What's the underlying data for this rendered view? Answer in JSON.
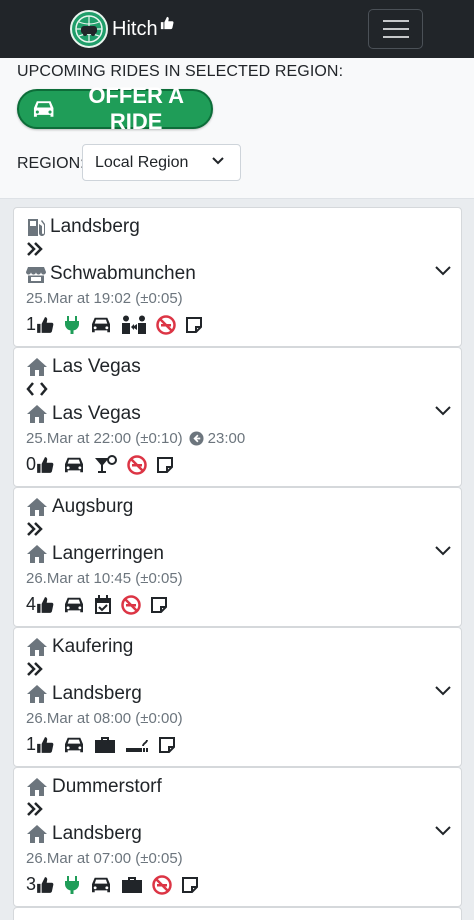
{
  "nav": {
    "brand": "Hitch"
  },
  "header": {
    "title": "UPCOMING RIDES IN SELECTED REGION:",
    "offer_button": "OFFER A RIDE",
    "region_label": "REGION:",
    "region_value": "Local Region"
  },
  "rides": [
    {
      "from": "Landsberg",
      "to": "Schwabmunchen",
      "when": "25.Mar at 19:02 (±0:05)",
      "return": "",
      "seats": "1",
      "from_icon": "fuel-icon",
      "to_icon": "store-icon",
      "direction": "one-way"
    },
    {
      "from": "Las Vegas",
      "to": "Las Vegas",
      "when": "25.Mar at 22:00 (±0:10)",
      "return": "23:00",
      "seats": "0",
      "from_icon": "home-icon",
      "to_icon": "home-icon",
      "direction": "round-trip"
    },
    {
      "from": "Augsburg",
      "to": "Langerringen",
      "when": "26.Mar at 10:45 (±0:05)",
      "return": "",
      "seats": "4",
      "from_icon": "home-icon",
      "to_icon": "home-icon",
      "direction": "one-way"
    },
    {
      "from": "Kaufering",
      "to": "Landsberg",
      "when": "26.Mar at 08:00 (±0:00)",
      "return": "",
      "seats": "1",
      "from_icon": "home-icon",
      "to_icon": "home-icon",
      "direction": "one-way"
    },
    {
      "from": "Dummerstorf",
      "to": "Landsberg",
      "when": "26.Mar at 07:00 (±0:05)",
      "return": "",
      "seats": "3",
      "from_icon": "home-icon",
      "to_icon": "home-icon",
      "direction": "one-way"
    }
  ],
  "colors": {
    "navbar": "#212529",
    "offer_button": "#1f9d58",
    "plug_icon": "#1f9d58",
    "no_smoking_icon": "#dc3545",
    "muted_text": "#6c757d"
  }
}
